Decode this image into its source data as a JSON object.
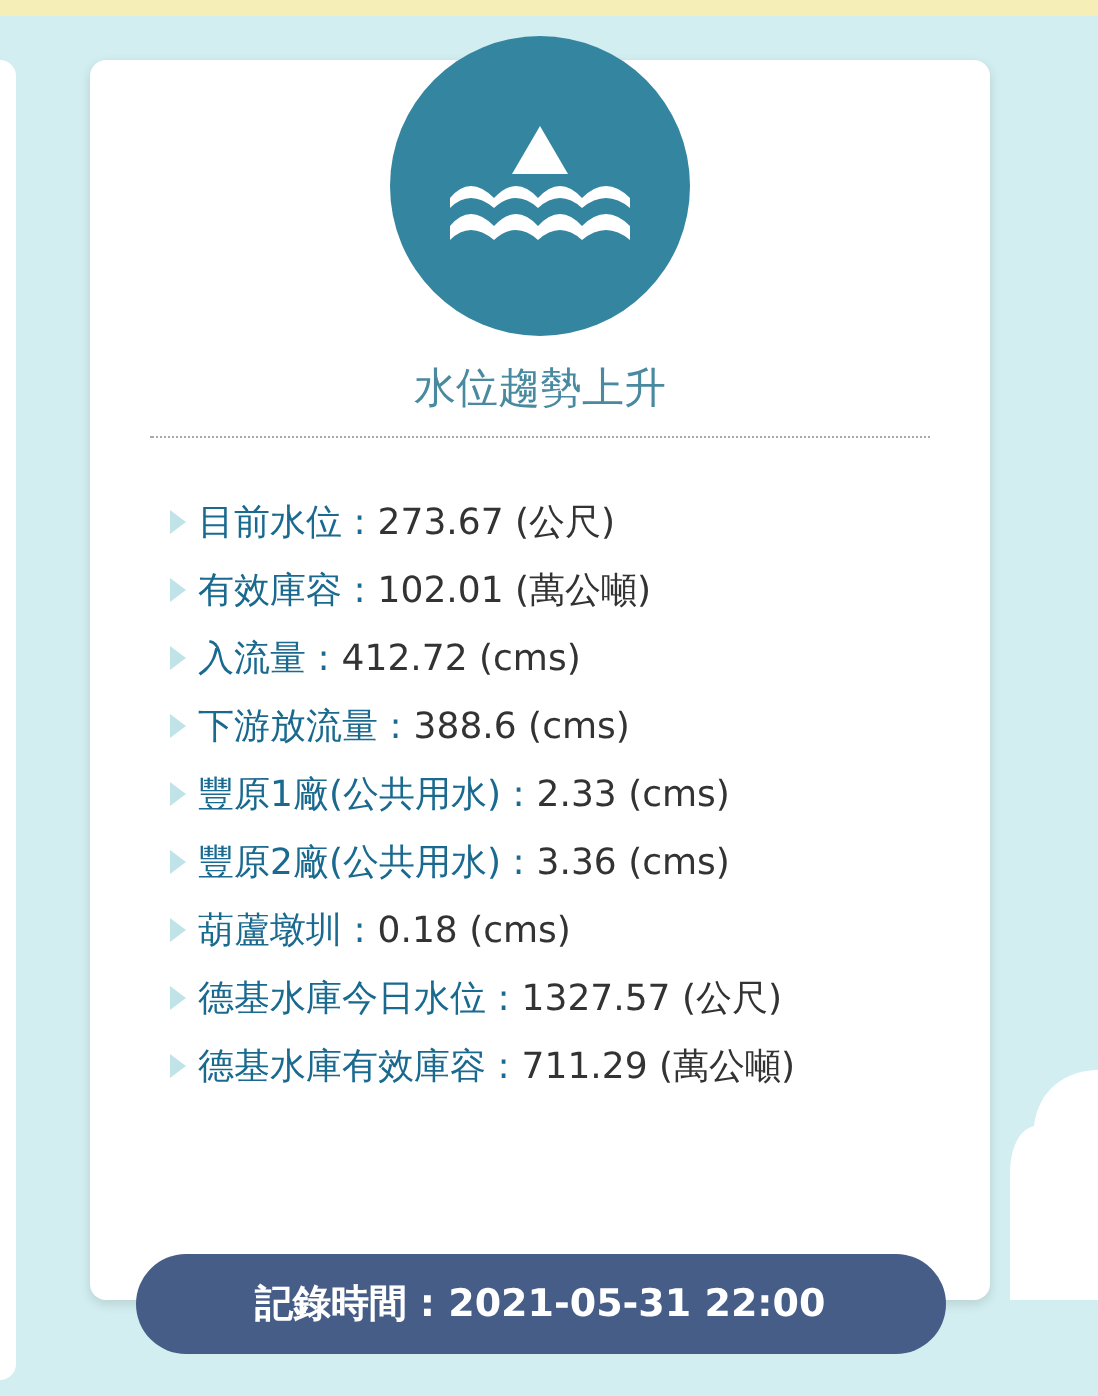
{
  "card": {
    "title": "水位趨勢上升",
    "items": [
      {
        "label": "目前水位 :",
        "value": "273.67 (公尺)"
      },
      {
        "label": "有效庫容 :",
        "value": "102.01 (萬公噸)"
      },
      {
        "label": "入流量 :",
        "value": "412.72 (cms)"
      },
      {
        "label": "下游放流量 :",
        "value": "388.6 (cms)"
      },
      {
        "label": "豐原1廠(公共用水) :",
        "value": "2.33 (cms)"
      },
      {
        "label": "豐原2廠(公共用水) :",
        "value": "3.36 (cms)"
      },
      {
        "label": "葫蘆墩圳 :",
        "value": "0.18 (cms)"
      },
      {
        "label": "德基水庫今日水位 :",
        "value": "1327.57 (公尺)"
      },
      {
        "label": "德基水庫有效庫容 :",
        "value": "711.29 (萬公噸)"
      }
    ],
    "record_time": "記錄時間 : 2021-05-31 22:00"
  }
}
